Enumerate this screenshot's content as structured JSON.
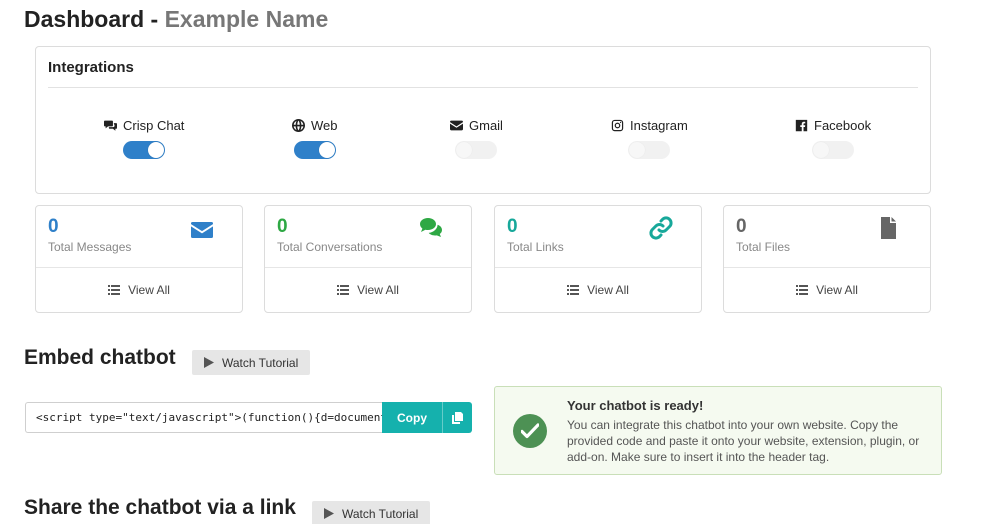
{
  "header": {
    "title": "Dashboard",
    "separator": "-",
    "name": "Example Name"
  },
  "integrations": {
    "title": "Integrations",
    "items": [
      {
        "label": "Crisp Chat",
        "icon": "comments-icon",
        "enabled": true
      },
      {
        "label": "Web",
        "icon": "globe-icon",
        "enabled": true
      },
      {
        "label": "Gmail",
        "icon": "envelope-icon",
        "enabled": false
      },
      {
        "label": "Instagram",
        "icon": "instagram-icon",
        "enabled": false
      },
      {
        "label": "Facebook",
        "icon": "facebook-icon",
        "enabled": false
      }
    ]
  },
  "stats": [
    {
      "value": "0",
      "label": "Total Messages",
      "icon": "envelope-icon",
      "color": "#2f80c9",
      "view": "View All"
    },
    {
      "value": "0",
      "label": "Total Conversations",
      "icon": "comments-icon",
      "color": "#2ea844",
      "view": "View All"
    },
    {
      "value": "0",
      "label": "Total Links",
      "icon": "link-icon",
      "color": "#17a89a",
      "view": "View All"
    },
    {
      "value": "0",
      "label": "Total Files",
      "icon": "file-icon",
      "color": "#666666",
      "view": "View All"
    }
  ],
  "embed": {
    "title": "Embed chatbot",
    "tutorial": "Watch Tutorial",
    "code": "<script type=\"text/javascript\">(function(){d=document;s=d.createE",
    "copy": "Copy"
  },
  "ready": {
    "title": "Your chatbot is ready!",
    "body": "You can integrate this chatbot into your own website. Copy the provided code and paste it onto your website, extension, plugin, or add-on. Make sure to insert it into the header tag."
  },
  "share": {
    "title": "Share the chatbot via a link",
    "tutorial": "Watch Tutorial"
  },
  "colors": {
    "toggle_on": "#2f80c9",
    "copy_button": "#15b1ad",
    "ready_check": "#4d9154"
  }
}
